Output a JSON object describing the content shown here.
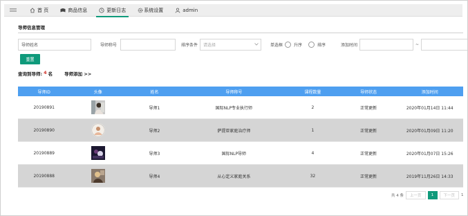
{
  "nav": {
    "items": [
      {
        "label": "首 页",
        "icon": "home-icon"
      },
      {
        "label": "商品信息",
        "icon": "book-icon"
      },
      {
        "label": "更新日志",
        "icon": "clock-icon"
      },
      {
        "label": "系统设置",
        "icon": "gear-icon"
      },
      {
        "label": "admin",
        "icon": "user-icon"
      }
    ],
    "active_index": 2,
    "accent_color": "#0f9a7b"
  },
  "page": {
    "title": "导师信息管理"
  },
  "filters": {
    "name_placeholder": "导师姓名",
    "title_label": "导师称号",
    "sort_label": "排序条件",
    "sort_placeholder": "请选择",
    "single_label": "单选框",
    "asc_label": "升序",
    "desc_label": "排序",
    "time_label": "添加时间",
    "range_sep": "~",
    "reset_label": "重置"
  },
  "summary": {
    "prefix": "查询到导师:",
    "count": "4",
    "suffix": "名",
    "add_link": "导师添加 >>"
  },
  "table": {
    "headers": [
      "导师ID",
      "头像",
      "姓名",
      "导师称号",
      "课程数量",
      "导师状态",
      "添加时间"
    ],
    "rows": [
      {
        "id": "20190891",
        "avatar": "avatar-1",
        "name": "导师1",
        "title": "国际NLP专业执行师",
        "courses": "2",
        "status": "正常更新",
        "time": "2020年01月14日 11:44"
      },
      {
        "id": "20190890",
        "avatar": "avatar-2",
        "name": "导师2",
        "title": "萨提亚家庭治疗师",
        "courses": "1",
        "status": "正常更新",
        "time": "2020年01月09日 11:20"
      },
      {
        "id": "20190889",
        "avatar": "avatar-3",
        "name": "导师3",
        "title": "国际NLP导师",
        "courses": "4",
        "status": "正常更新",
        "time": "2020年01月07日 15:26"
      },
      {
        "id": "20190888",
        "avatar": "avatar-4",
        "name": "导师4",
        "title": "从心定义家庭关系",
        "courses": "32",
        "status": "正常更新",
        "time": "2019年11月26日 14:33"
      }
    ],
    "header_color": "#4e9ff0",
    "alt_row_color": "#d5d5d5"
  },
  "pager": {
    "total": "共 4 条",
    "prev": "上一页",
    "current": "1",
    "next": "下一页",
    "last": "1"
  }
}
